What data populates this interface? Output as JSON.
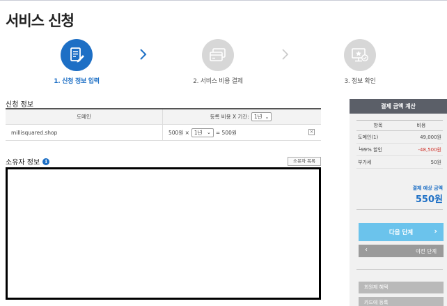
{
  "page": {
    "title": "서비스 신청"
  },
  "steps": [
    {
      "label": "1. 신청 정보 입력",
      "icon": "document-edit-icon",
      "active": true
    },
    {
      "label": "2. 서비스 비용 결제",
      "icon": "credit-card-icon",
      "active": false
    },
    {
      "label": "3. 정보 확인",
      "icon": "monitor-check-icon",
      "active": false
    }
  ],
  "application": {
    "section_label": "신청 정보",
    "headers": {
      "domain": "도메인",
      "fee_period": "등록 비용 X 기간:"
    },
    "period_select": "1년",
    "row": {
      "domain": "millisquared.shop",
      "price": "500원 ×",
      "period": "1년",
      "total": "= 500원",
      "remove": "×"
    }
  },
  "owner": {
    "section_label": "소유자 정보",
    "info_icon": "i",
    "list_button": "소유자 목록"
  },
  "payment": {
    "title": "결제 금액 계산",
    "headers": {
      "item": "항목",
      "cost": "비용"
    },
    "rows": [
      {
        "item": "도메인(1)",
        "cost": "49,000원"
      },
      {
        "item": "└99% 할인",
        "cost": "-48,500원"
      },
      {
        "item": "부가세",
        "cost": "50원"
      }
    ],
    "total_label": "결제 예상 금액",
    "total_value": "550원",
    "next_button": "다음 단계",
    "prev_button": "이전 단계",
    "button_a": "회원제 혜택",
    "button_b": "카드에 등록"
  },
  "colors": {
    "accent": "#1d6fc5",
    "next_button": "#6bc3ec",
    "discount": "#d0342c",
    "panel_header": "#5b5f68"
  }
}
